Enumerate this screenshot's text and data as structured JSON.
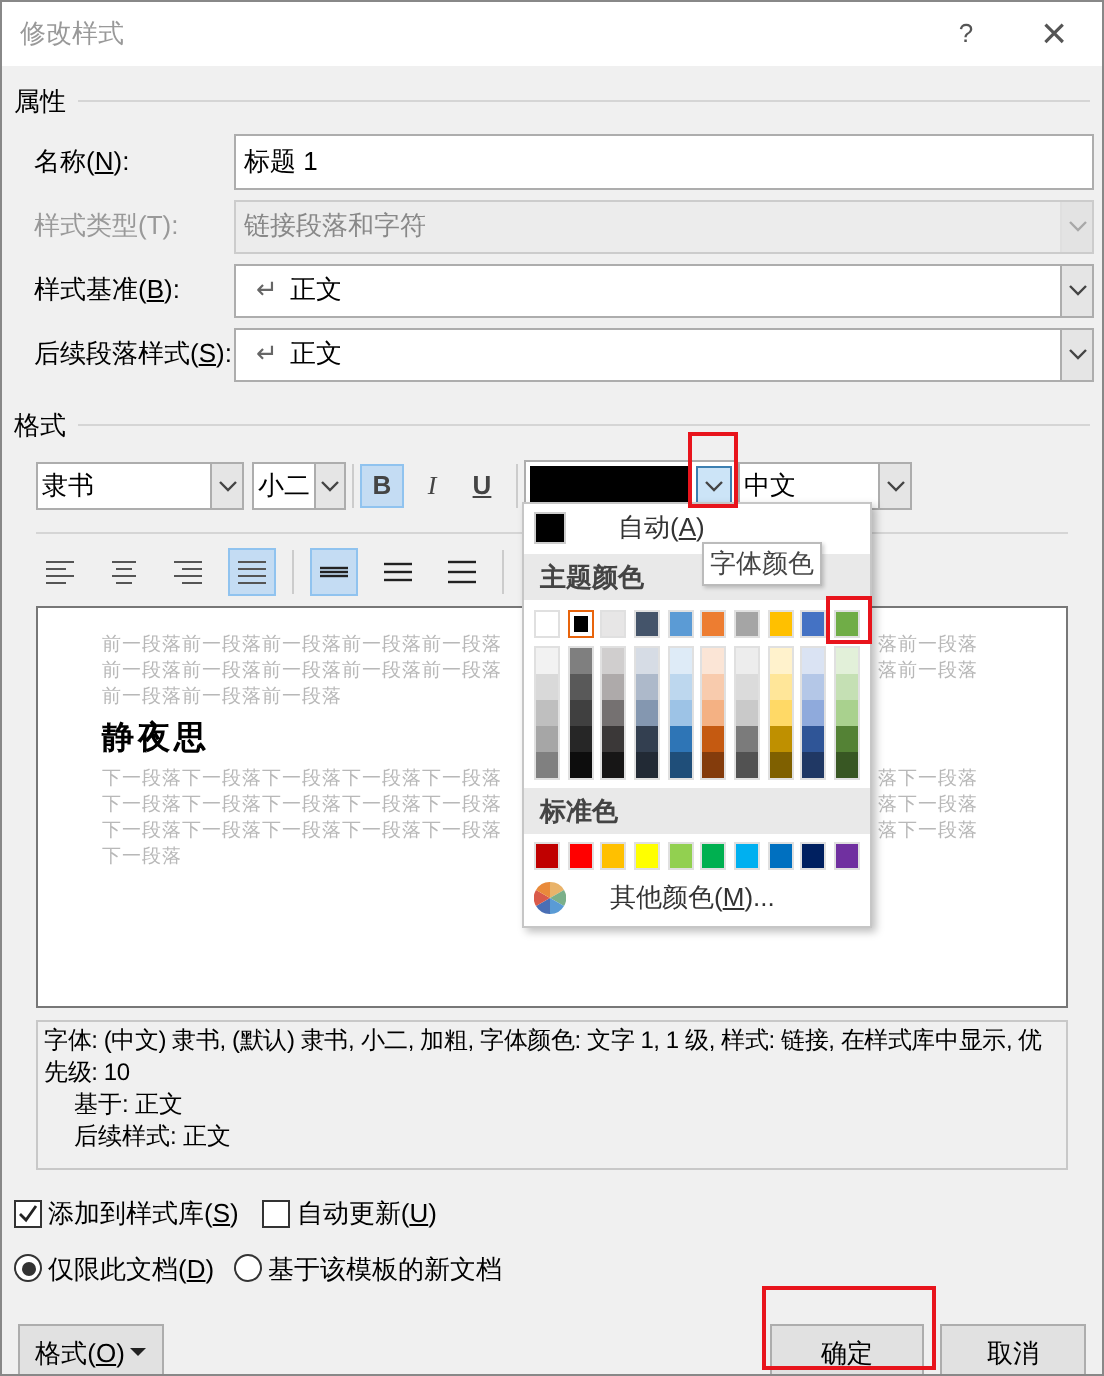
{
  "window": {
    "title": "修改样式",
    "help": "?",
    "close": "×"
  },
  "properties": {
    "heading": "属性",
    "rows": [
      {
        "kind": "input",
        "label": {
          "before": "名称(",
          "key": "N",
          "after": "):"
        },
        "value": "标题 1",
        "disabled": false
      },
      {
        "kind": "select",
        "label": {
          "before": "样式类型(T):"
        },
        "value": "链接段落和字符",
        "disabled": true
      },
      {
        "kind": "select",
        "label": {
          "before": "样式基准(",
          "key": "B",
          "after": "):"
        },
        "mark": "↵",
        "value": "正文",
        "disabled": false
      },
      {
        "kind": "select",
        "label": {
          "before": "后续段落样式(",
          "key": "S",
          "after": "):"
        },
        "mark": "↵",
        "value": "正文",
        "disabled": false
      }
    ]
  },
  "format": {
    "heading": "格式",
    "font": "隶书",
    "size": "小二",
    "styles": [
      {
        "kind": "bold",
        "label": "B",
        "on": true
      },
      {
        "kind": "italic",
        "label": "I",
        "on": false
      },
      {
        "kind": "underline",
        "label": "U",
        "on": false
      }
    ],
    "font_color": {
      "color": "#000000"
    },
    "script": "中文",
    "alignment": [
      {
        "kind": "left",
        "selected": false
      },
      {
        "kind": "center",
        "selected": false
      },
      {
        "kind": "right",
        "selected": false
      },
      {
        "kind": "justify",
        "selected": true
      }
    ],
    "spacing": [
      {
        "kind": "single",
        "selected": true
      },
      {
        "kind": "onehalf",
        "selected": false
      },
      {
        "kind": "double",
        "selected": false
      }
    ]
  },
  "preview": {
    "before": [
      {
        "left": "前一段落前一段落前一段落前一段落前一段落",
        "right": "落前一段落"
      },
      {
        "left": "前一段落前一段落前一段落前一段落前一段落",
        "right": "落前一段落"
      },
      {
        "left": "前一段落前一段落前一段落"
      }
    ],
    "sample": "静夜思",
    "after": [
      {
        "left": "下一段落下一段落下一段落下一段落下一段落",
        "right": "落下一段落"
      },
      {
        "left": "下一段落下一段落下一段落下一段落下一段落",
        "right": "落下一段落"
      },
      {
        "left": "下一段落下一段落下一段落下一段落下一段落",
        "right": "落下一段落"
      },
      {
        "left": "下一段落"
      }
    ]
  },
  "description": [
    "字体: (中文) 隶书, (默认) 隶书, 小二, 加粗, 字体颜色: 文字 1, 1 级, 样式: 链接, 在样式库中显示, 优先级: 10",
    "基于: 正文",
    "后续样式: 正文"
  ],
  "options": [
    {
      "kind": "checkbox",
      "label": {
        "before": "添加到样式库(",
        "key": "S",
        "after": ")"
      },
      "checked": true
    },
    {
      "kind": "checkbox",
      "label": {
        "before": "自动更新(",
        "key": "U",
        "after": ")"
      },
      "checked": false
    },
    {
      "kind": "radio",
      "label": {
        "before": "仅限此文档(",
        "key": "D",
        "after": ")"
      },
      "selected": true
    },
    {
      "kind": "radio",
      "label": {
        "before": "基于该模板的新文档"
      },
      "selected": false
    }
  ],
  "buttons": [
    {
      "kind": "menu",
      "label": {
        "before": "格式(",
        "key": "O",
        "after": ")"
      }
    },
    {
      "kind": "ok",
      "label": {
        "before": "确定"
      }
    },
    {
      "kind": "cancel",
      "label": {
        "before": "取消"
      }
    }
  ],
  "color_menu": {
    "auto": {
      "color": "#000000",
      "label": {
        "before": "自动(",
        "key": "A",
        "after": ")"
      }
    },
    "theme_heading": "主题颜色",
    "standard_heading": "标准色",
    "theme": [
      {
        "color": "#ffffff",
        "selected": false,
        "shades": [
          {
            "color": "#f2f2f2"
          },
          {
            "color": "#d9d9d9"
          },
          {
            "color": "#bfbfbf"
          },
          {
            "color": "#a6a6a6"
          },
          {
            "color": "#808080"
          }
        ]
      },
      {
        "color": "#000000",
        "selected": true,
        "shades": [
          {
            "color": "#7f7f7f"
          },
          {
            "color": "#595959"
          },
          {
            "color": "#404040"
          },
          {
            "color": "#262626"
          },
          {
            "color": "#0d0d0d"
          }
        ]
      },
      {
        "color": "#e7e6e6",
        "selected": false,
        "shades": [
          {
            "color": "#d0cece"
          },
          {
            "color": "#aeaaaa"
          },
          {
            "color": "#757171"
          },
          {
            "color": "#3b3838"
          },
          {
            "color": "#171616"
          }
        ]
      },
      {
        "color": "#44546a",
        "selected": false,
        "shades": [
          {
            "color": "#d6dce5"
          },
          {
            "color": "#adb9ca"
          },
          {
            "color": "#8497b0"
          },
          {
            "color": "#333f50"
          },
          {
            "color": "#222a35"
          }
        ]
      },
      {
        "color": "#5b9bd5",
        "selected": false,
        "shades": [
          {
            "color": "#deebf7"
          },
          {
            "color": "#bdd7ee"
          },
          {
            "color": "#9dc3e6"
          },
          {
            "color": "#2e75b6"
          },
          {
            "color": "#1f4e79"
          }
        ]
      },
      {
        "color": "#ed7d31",
        "selected": false,
        "shades": [
          {
            "color": "#fbe5d6"
          },
          {
            "color": "#f8cbad"
          },
          {
            "color": "#f4b183"
          },
          {
            "color": "#c55a11"
          },
          {
            "color": "#843c0c"
          }
        ]
      },
      {
        "color": "#a5a5a5",
        "selected": false,
        "shades": [
          {
            "color": "#ededed"
          },
          {
            "color": "#dbdbdb"
          },
          {
            "color": "#c9c9c9"
          },
          {
            "color": "#7b7b7b"
          },
          {
            "color": "#525252"
          }
        ]
      },
      {
        "color": "#ffc000",
        "selected": false,
        "shades": [
          {
            "color": "#fff2cc"
          },
          {
            "color": "#ffe699"
          },
          {
            "color": "#ffd966"
          },
          {
            "color": "#bf9000"
          },
          {
            "color": "#7f6000"
          }
        ]
      },
      {
        "color": "#4472c4",
        "selected": false,
        "shades": [
          {
            "color": "#dae3f3"
          },
          {
            "color": "#b4c7e7"
          },
          {
            "color": "#8faadc"
          },
          {
            "color": "#2f5597"
          },
          {
            "color": "#203864"
          }
        ]
      },
      {
        "color": "#70ad47",
        "selected": false,
        "shades": [
          {
            "color": "#e2f0d9"
          },
          {
            "color": "#c5e0b4"
          },
          {
            "color": "#a9d18e"
          },
          {
            "color": "#548235"
          },
          {
            "color": "#385723"
          }
        ]
      }
    ],
    "standard": [
      {
        "color": "#c00000"
      },
      {
        "color": "#ff0000"
      },
      {
        "color": "#ffc000"
      },
      {
        "color": "#ffff00"
      },
      {
        "color": "#92d050"
      },
      {
        "color": "#00b050"
      },
      {
        "color": "#00b0f0"
      },
      {
        "color": "#0070c0"
      },
      {
        "color": "#002060"
      },
      {
        "color": "#7030a0"
      }
    ],
    "more": {
      "before": "其他颜色(",
      "key": "M",
      "after": ")..."
    }
  },
  "tooltip": "字体颜色",
  "highlight_frames": [
    {
      "kind": "font-color-dropdown"
    },
    {
      "kind": "green-swatch"
    },
    {
      "kind": "ok-button"
    }
  ]
}
